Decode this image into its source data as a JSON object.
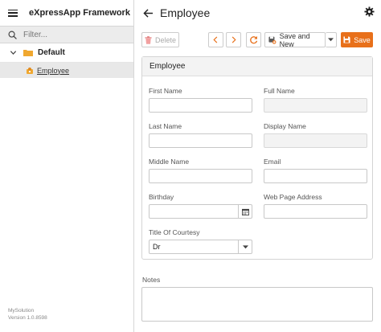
{
  "app": {
    "title": "eXpressApp Framework"
  },
  "sidebar": {
    "filter_placeholder": "Filter...",
    "group_label": "Default",
    "item_label": "Employee",
    "footer_line1": "MySolution",
    "footer_line2": "Version 1.0.8598"
  },
  "header": {
    "title": "Employee"
  },
  "toolbar": {
    "delete_label": "Delete",
    "save_and_new_label": "Save and New",
    "save_label": "Save"
  },
  "form": {
    "section_title": "Employee",
    "first_name_label": "First Name",
    "first_name_value": "",
    "full_name_label": "Full Name",
    "full_name_value": "",
    "last_name_label": "Last Name",
    "last_name_value": "",
    "display_name_label": "Display Name",
    "display_name_value": "",
    "middle_name_label": "Middle Name",
    "middle_name_value": "",
    "email_label": "Email",
    "email_value": "",
    "birthday_label": "Birthday",
    "birthday_value": "",
    "web_page_label": "Web Page Address",
    "web_page_value": "",
    "title_of_courtesy_label": "Title Of Courtesy",
    "title_of_courtesy_value": "Dr",
    "notes_label": "Notes",
    "notes_value": ""
  },
  "colors": {
    "accent": "#e8701a",
    "refresh_icon": "#e8701a",
    "folder": "#f0a830"
  },
  "icons": {
    "menu": "hamburger-icon",
    "search": "search-icon",
    "expand": "chevron-down-icon",
    "folder": "folder-icon",
    "employee": "employee-icon",
    "back": "arrow-left-icon",
    "settings": "gear-icon",
    "delete": "trash-icon",
    "prev": "chevron-left-icon",
    "next": "chevron-right-icon",
    "refresh": "refresh-icon",
    "save_and_new": "save-new-icon",
    "dropdown": "caret-down-icon",
    "save": "save-icon",
    "calendar": "calendar-icon"
  }
}
